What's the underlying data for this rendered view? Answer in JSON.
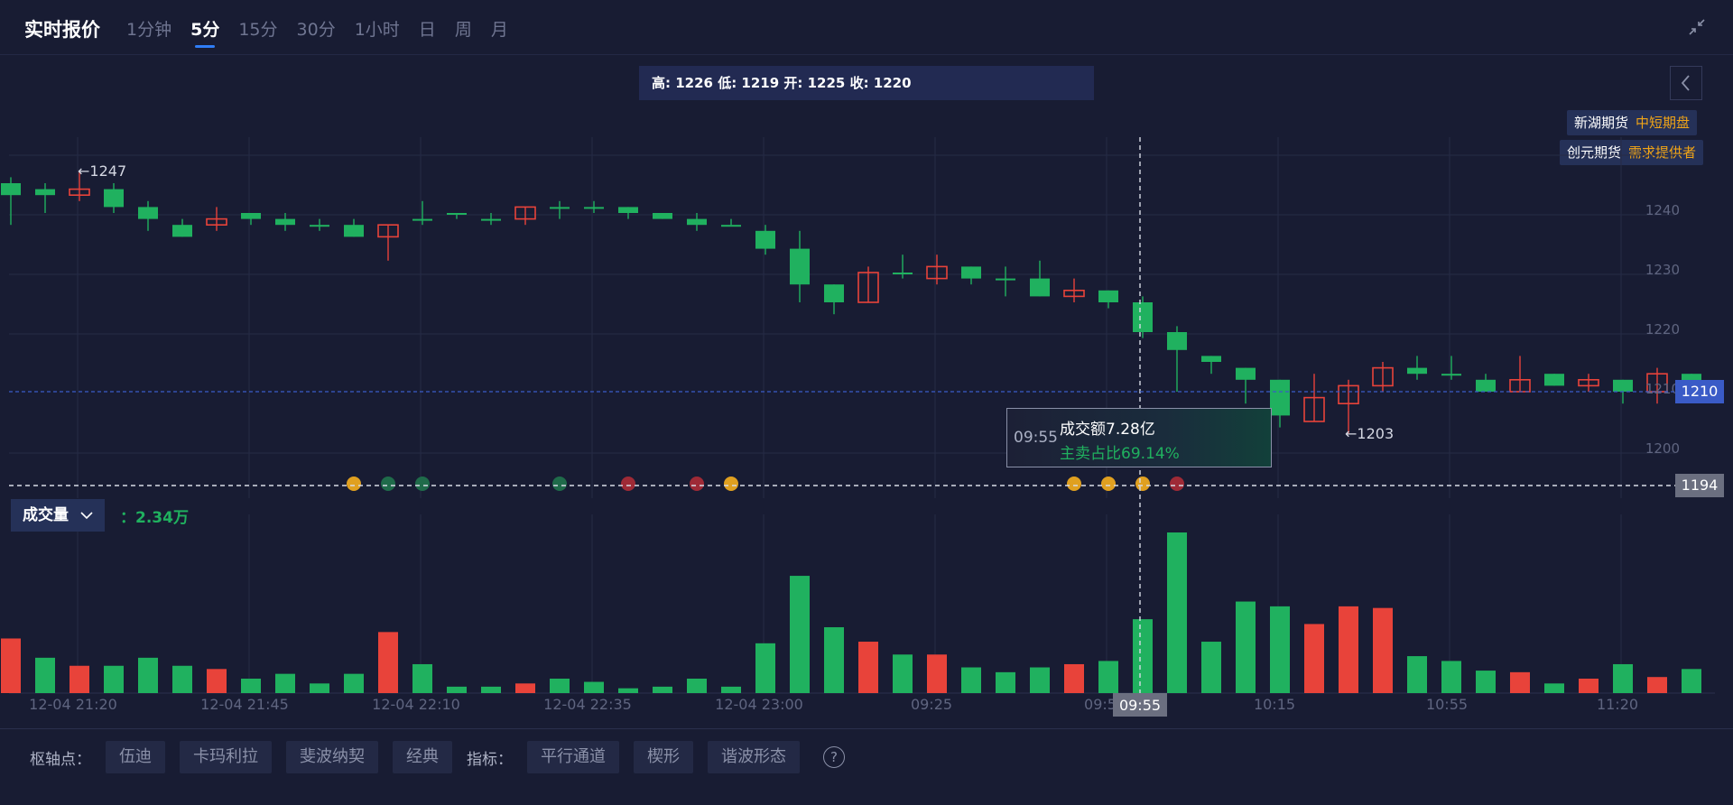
{
  "header": {
    "title": "实时报价",
    "tabs": [
      "1分钟",
      "5分",
      "15分",
      "30分",
      "1小时",
      "日",
      "周",
      "月"
    ],
    "active_tab": "5分"
  },
  "ohlc_bar": {
    "text": "高: 1226 低: 1219 开: 1225 收: 1220"
  },
  "badges": [
    {
      "name": "新湖期货",
      "tag": "中短期盘"
    },
    {
      "name": "创元期货",
      "tag": "需求提供者"
    }
  ],
  "price_axis": {
    "ticks": [
      "1240",
      "1230",
      "1220",
      "1210",
      "1200"
    ]
  },
  "annotations": {
    "high_label": "←1247",
    "low_label": "←1203"
  },
  "current_price": "1210",
  "crosshair_price": "1194",
  "volume": {
    "selector_label": "成交量",
    "value": "：2.34万"
  },
  "tooltip": {
    "time": "09:55",
    "line1": "成交额7.28亿",
    "line2": "主卖占比69.14%"
  },
  "time_axis": {
    "labels": [
      "12-04 21:20",
      "12-04 21:45",
      "12-04 22:10",
      "12-04 22:35",
      "12-04 23:00",
      "09:25",
      "09:5",
      "10:15",
      "10:55",
      "11:20"
    ],
    "crosshair_label": "09:55"
  },
  "bottom_toolbar": {
    "pivot_label": "枢轴点：",
    "pivot_buttons": [
      "伍迪",
      "卡玛利拉",
      "斐波纳契",
      "经典"
    ],
    "indicator_label": "指标：",
    "indicator_buttons": [
      "平行通道",
      "楔形",
      "谐波形态"
    ]
  },
  "colors": {
    "up": "#e8433a",
    "down": "#20b15f",
    "accent": "#2f7df6",
    "background": "#181c33"
  },
  "chart_data": {
    "type": "candlestick",
    "price_range": [
      1194,
      1247
    ],
    "candles": [
      {
        "o": 1245,
        "c": 1243,
        "h": 1246,
        "l": 1238
      },
      {
        "o": 1244,
        "c": 1243,
        "h": 1245,
        "l": 1240
      },
      {
        "o": 1243,
        "c": 1244,
        "h": 1247,
        "l": 1242
      },
      {
        "o": 1244,
        "c": 1241,
        "h": 1245,
        "l": 1240
      },
      {
        "o": 1241,
        "c": 1239,
        "h": 1242,
        "l": 1237
      },
      {
        "o": 1238,
        "c": 1236,
        "h": 1239,
        "l": 1236
      },
      {
        "o": 1238,
        "c": 1239,
        "h": 1241,
        "l": 1237
      },
      {
        "o": 1240,
        "c": 1239,
        "h": 1240,
        "l": 1238
      },
      {
        "o": 1239,
        "c": 1238,
        "h": 1240,
        "l": 1237
      },
      {
        "o": 1238,
        "c": 1238,
        "h": 1239,
        "l": 1237
      },
      {
        "o": 1238,
        "c": 1236,
        "h": 1239,
        "l": 1236
      },
      {
        "o": 1236,
        "c": 1238,
        "h": 1238,
        "l": 1232
      },
      {
        "o": 1239,
        "c": 1239,
        "h": 1242,
        "l": 1238
      },
      {
        "o": 1240,
        "c": 1240,
        "h": 1240,
        "l": 1239
      },
      {
        "o": 1239,
        "c": 1239,
        "h": 1240,
        "l": 1238
      },
      {
        "o": 1239,
        "c": 1241,
        "h": 1241,
        "l": 1238
      },
      {
        "o": 1241,
        "c": 1241,
        "h": 1242,
        "l": 1239
      },
      {
        "o": 1241,
        "c": 1241,
        "h": 1242,
        "l": 1240
      },
      {
        "o": 1241,
        "c": 1240,
        "h": 1241,
        "l": 1239
      },
      {
        "o": 1240,
        "c": 1239,
        "h": 1240,
        "l": 1239
      },
      {
        "o": 1239,
        "c": 1238,
        "h": 1240,
        "l": 1237
      },
      {
        "o": 1238,
        "c": 1238,
        "h": 1239,
        "l": 1238
      },
      {
        "o": 1237,
        "c": 1234,
        "h": 1238,
        "l": 1233
      },
      {
        "o": 1234,
        "c": 1228,
        "h": 1237,
        "l": 1225
      },
      {
        "o": 1228,
        "c": 1225,
        "h": 1228,
        "l": 1223
      },
      {
        "o": 1225,
        "c": 1230,
        "h": 1231,
        "l": 1225
      },
      {
        "o": 1230,
        "c": 1230,
        "h": 1233,
        "l": 1229
      },
      {
        "o": 1229,
        "c": 1231,
        "h": 1233,
        "l": 1228
      },
      {
        "o": 1231,
        "c": 1229,
        "h": 1231,
        "l": 1228
      },
      {
        "o": 1229,
        "c": 1229,
        "h": 1231,
        "l": 1226
      },
      {
        "o": 1229,
        "c": 1226,
        "h": 1232,
        "l": 1226
      },
      {
        "o": 1226,
        "c": 1227,
        "h": 1229,
        "l": 1225
      },
      {
        "o": 1227,
        "c": 1225,
        "h": 1227,
        "l": 1224
      },
      {
        "o": 1225,
        "c": 1220,
        "h": 1226,
        "l": 1219
      },
      {
        "o": 1220,
        "c": 1217,
        "h": 1221,
        "l": 1210
      },
      {
        "o": 1216,
        "c": 1215,
        "h": 1216,
        "l": 1213
      },
      {
        "o": 1214,
        "c": 1212,
        "h": 1214,
        "l": 1208
      },
      {
        "o": 1212,
        "c": 1206,
        "h": 1212,
        "l": 1204
      },
      {
        "o": 1205,
        "c": 1209,
        "h": 1213,
        "l": 1205
      },
      {
        "o": 1208,
        "c": 1211,
        "h": 1212,
        "l": 1203
      },
      {
        "o": 1211,
        "c": 1214,
        "h": 1215,
        "l": 1210
      },
      {
        "o": 1214,
        "c": 1213,
        "h": 1216,
        "l": 1212
      },
      {
        "o": 1213,
        "c": 1213,
        "h": 1216,
        "l": 1212
      },
      {
        "o": 1212,
        "c": 1210,
        "h": 1213,
        "l": 1210
      },
      {
        "o": 1210,
        "c": 1212,
        "h": 1216,
        "l": 1210
      },
      {
        "o": 1213,
        "c": 1211,
        "h": 1213,
        "l": 1211
      },
      {
        "o": 1211,
        "c": 1212,
        "h": 1213,
        "l": 1210
      },
      {
        "o": 1212,
        "c": 1210,
        "h": 1212,
        "l": 1208
      },
      {
        "o": 1210,
        "c": 1213,
        "h": 1214,
        "l": 1208
      },
      {
        "o": 1213,
        "c": 1211,
        "h": 1213,
        "l": 1210
      }
    ],
    "volumes": [
      {
        "v": 0.34,
        "up": true
      },
      {
        "v": 0.22,
        "up": false
      },
      {
        "v": 0.17,
        "up": true
      },
      {
        "v": 0.17,
        "up": false
      },
      {
        "v": 0.22,
        "up": false
      },
      {
        "v": 0.17,
        "up": false
      },
      {
        "v": 0.15,
        "up": true
      },
      {
        "v": 0.09,
        "up": false
      },
      {
        "v": 0.12,
        "up": false
      },
      {
        "v": 0.06,
        "up": false
      },
      {
        "v": 0.12,
        "up": false
      },
      {
        "v": 0.38,
        "up": true
      },
      {
        "v": 0.18,
        "up": false
      },
      {
        "v": 0.04,
        "up": false
      },
      {
        "v": 0.04,
        "up": false
      },
      {
        "v": 0.06,
        "up": true
      },
      {
        "v": 0.09,
        "up": false
      },
      {
        "v": 0.07,
        "up": false
      },
      {
        "v": 0.03,
        "up": false
      },
      {
        "v": 0.04,
        "up": false
      },
      {
        "v": 0.09,
        "up": false
      },
      {
        "v": 0.04,
        "up": false
      },
      {
        "v": 0.31,
        "up": false
      },
      {
        "v": 0.73,
        "up": false
      },
      {
        "v": 0.41,
        "up": false
      },
      {
        "v": 0.32,
        "up": true
      },
      {
        "v": 0.24,
        "up": false
      },
      {
        "v": 0.24,
        "up": true
      },
      {
        "v": 0.16,
        "up": false
      },
      {
        "v": 0.13,
        "up": false
      },
      {
        "v": 0.16,
        "up": false
      },
      {
        "v": 0.18,
        "up": true
      },
      {
        "v": 0.2,
        "up": false
      },
      {
        "v": 0.46,
        "up": false
      },
      {
        "v": 1.0,
        "up": false
      },
      {
        "v": 0.32,
        "up": false
      },
      {
        "v": 0.57,
        "up": false
      },
      {
        "v": 0.54,
        "up": false
      },
      {
        "v": 0.43,
        "up": true
      },
      {
        "v": 0.54,
        "up": true
      },
      {
        "v": 0.53,
        "up": true
      },
      {
        "v": 0.23,
        "up": false
      },
      {
        "v": 0.2,
        "up": false
      },
      {
        "v": 0.14,
        "up": false
      },
      {
        "v": 0.13,
        "up": true
      },
      {
        "v": 0.06,
        "up": false
      },
      {
        "v": 0.09,
        "up": true
      },
      {
        "v": 0.18,
        "up": false
      },
      {
        "v": 0.1,
        "up": true
      },
      {
        "v": 0.15,
        "up": false
      }
    ],
    "markers": [
      {
        "candle": 10,
        "kind": "gold"
      },
      {
        "candle": 11,
        "kind": "green"
      },
      {
        "candle": 12,
        "kind": "green"
      },
      {
        "candle": 16,
        "kind": "green"
      },
      {
        "candle": 18,
        "kind": "red"
      },
      {
        "candle": 20,
        "kind": "red"
      },
      {
        "candle": 21,
        "kind": "gold"
      },
      {
        "candle": 31,
        "kind": "gold"
      },
      {
        "candle": 32,
        "kind": "gold"
      },
      {
        "candle": 33,
        "kind": "gold"
      },
      {
        "candle": 34,
        "kind": "red"
      }
    ],
    "grid": true
  }
}
